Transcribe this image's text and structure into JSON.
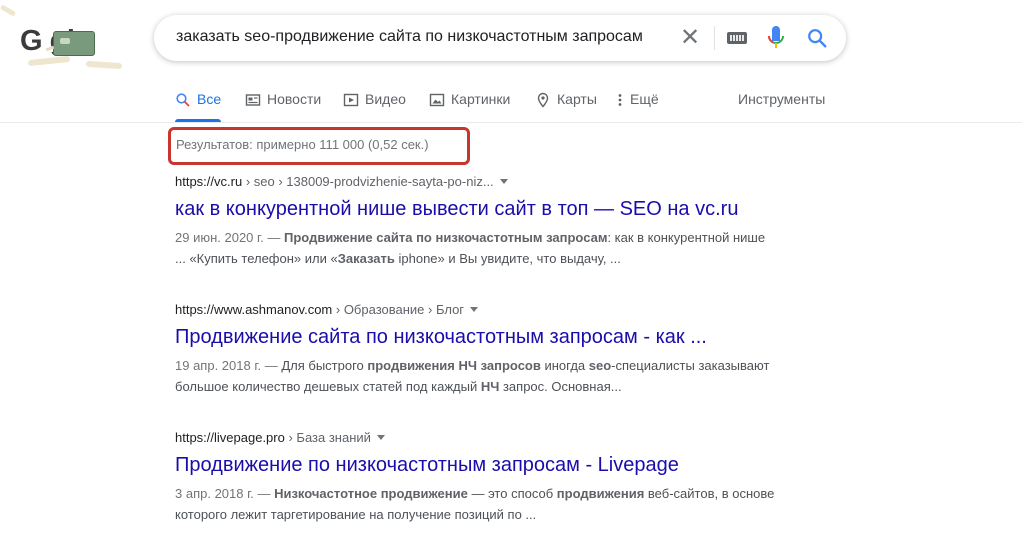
{
  "logo": {
    "text": "G  gle"
  },
  "search": {
    "query": "заказать seo-продвижение сайта по низкочастотным запросам",
    "clear_symbol": "✕"
  },
  "tabs": [
    {
      "label": "Все",
      "icon": "search-icon",
      "active": true
    },
    {
      "label": "Новости",
      "icon": "news-icon",
      "active": false
    },
    {
      "label": "Видео",
      "icon": "video-icon",
      "active": false
    },
    {
      "label": "Картинки",
      "icon": "image-icon",
      "active": false
    },
    {
      "label": "Карты",
      "icon": "map-pin-icon",
      "active": false
    },
    {
      "label": "Ещё",
      "icon": "more-vert-icon",
      "active": false
    }
  ],
  "tools_label": "Инструменты",
  "stats": "Результатов: примерно 111 000 (0,52 сек.)",
  "colors": {
    "link": "#1a0dab",
    "accent": "#1a73e8",
    "highlight": "#c8372d"
  },
  "results": [
    {
      "url_host": "https://vc.ru",
      "url_path": " › seo › 138009-prodvizhenie-sayta-po-niz...",
      "title": "как в конкурентной нише вывести сайт в топ — SEO на vc.ru",
      "date": "29 июн. 2020 г. — ",
      "snippet": [
        {
          "t": "Продвижение сайта по низкочастотным запросам",
          "b": true
        },
        {
          "t": ": как в конкурентной нише ... «Купить телефон» или «",
          "b": false
        },
        {
          "t": "Заказать",
          "b": true
        },
        {
          "t": " iphone» и Вы увидите, что выдачу, ...",
          "b": false
        }
      ]
    },
    {
      "url_host": "https://www.ashmanov.com",
      "url_path": " › Образование › Блог",
      "title": "Продвижение сайта по низкочастотным запросам - как ...",
      "date": "19 апр. 2018 г. — ",
      "snippet": [
        {
          "t": "Для быстрого ",
          "b": false
        },
        {
          "t": "продвижения НЧ запросов",
          "b": true
        },
        {
          "t": " иногда ",
          "b": false
        },
        {
          "t": "seo",
          "b": true
        },
        {
          "t": "-специалисты заказывают большое количество дешевых статей под каждый ",
          "b": false
        },
        {
          "t": "НЧ",
          "b": true
        },
        {
          "t": " запрос. Основная...",
          "b": false
        }
      ]
    },
    {
      "url_host": "https://livepage.pro",
      "url_path": " › База знаний",
      "title": "Продвижение по низкочастотным запросам - Livepage",
      "date": "3 апр. 2018 г. — ",
      "snippet": [
        {
          "t": "Низкочастотное продвижение",
          "b": true
        },
        {
          "t": " — это способ ",
          "b": false
        },
        {
          "t": "продвижения",
          "b": true
        },
        {
          "t": " веб-сайтов, в основе которого лежит таргетирование на получение позиций по ...",
          "b": false
        }
      ]
    }
  ]
}
